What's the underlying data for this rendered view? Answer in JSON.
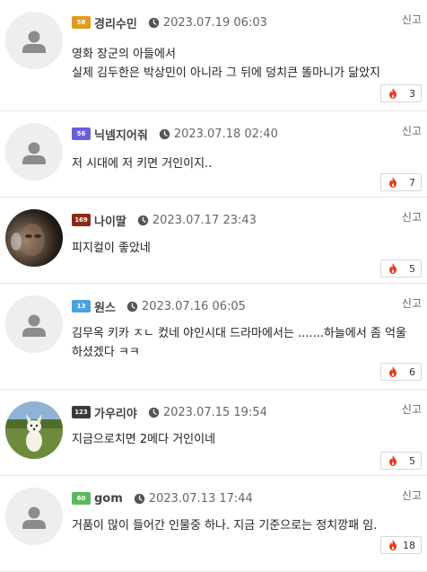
{
  "comments": [
    {
      "level": "58",
      "level_color": "#e39a1c",
      "nickname": "경리수민",
      "date": "2023.07.19 06:03",
      "report": "신고",
      "lines": [
        "영화 장군의 아들에서",
        "실제 김두한은 박상민이 아니라 그 뒤에 덩치큰 똘마니가 닮았지"
      ],
      "likes": "3",
      "avatar": "default"
    },
    {
      "level": "56",
      "level_color": "#6a5fd6",
      "nickname": "닉넴지어줘",
      "date": "2023.07.18 02:40",
      "report": "신고",
      "lines": [
        "저 시대에 저 키면 거인이지.."
      ],
      "likes": "7",
      "avatar": "default"
    },
    {
      "level": "169",
      "level_color": "#8b2a1a",
      "nickname": "나이딸",
      "date": "2023.07.17 23:43",
      "report": "신고",
      "lines": [
        "피지컬이 좋았네"
      ],
      "likes": "5",
      "avatar": "photo-dark"
    },
    {
      "level": "13",
      "level_color": "#4aa3e0",
      "nickname": "원스",
      "date": "2023.07.16 06:05",
      "report": "신고",
      "lines": [
        "김무옥 키카 ㅈㄴ 컸네 야인시대 드라마에서는 .......하늘에서 좀 억울",
        "하셨겠다 ㅋㅋ"
      ],
      "likes": "6",
      "avatar": "default"
    },
    {
      "level": "123",
      "level_color": "#3a3a3a",
      "nickname": "가우리야",
      "date": "2023.07.15 19:54",
      "report": "신고",
      "lines": [
        "지금으로치면 2메다 거인이네"
      ],
      "likes": "5",
      "avatar": "photo-dog"
    },
    {
      "level": "60",
      "level_color": "#5cb85c",
      "nickname": "gom",
      "date": "2023.07.13 17:44",
      "report": "신고",
      "lines": [
        "거품이 많이 들어간 인물중 하나. 지금 기준으로는 정치깡패 임."
      ],
      "likes": "18",
      "avatar": "default"
    }
  ],
  "icons": {
    "clock": "clock-icon",
    "like": "flame-icon",
    "avatar": "person-icon"
  },
  "colors": {
    "like": "#e8391e",
    "divider": "#e5e5e5",
    "avatar_bg": "#eeeeee",
    "person": "#8c8c8c"
  }
}
